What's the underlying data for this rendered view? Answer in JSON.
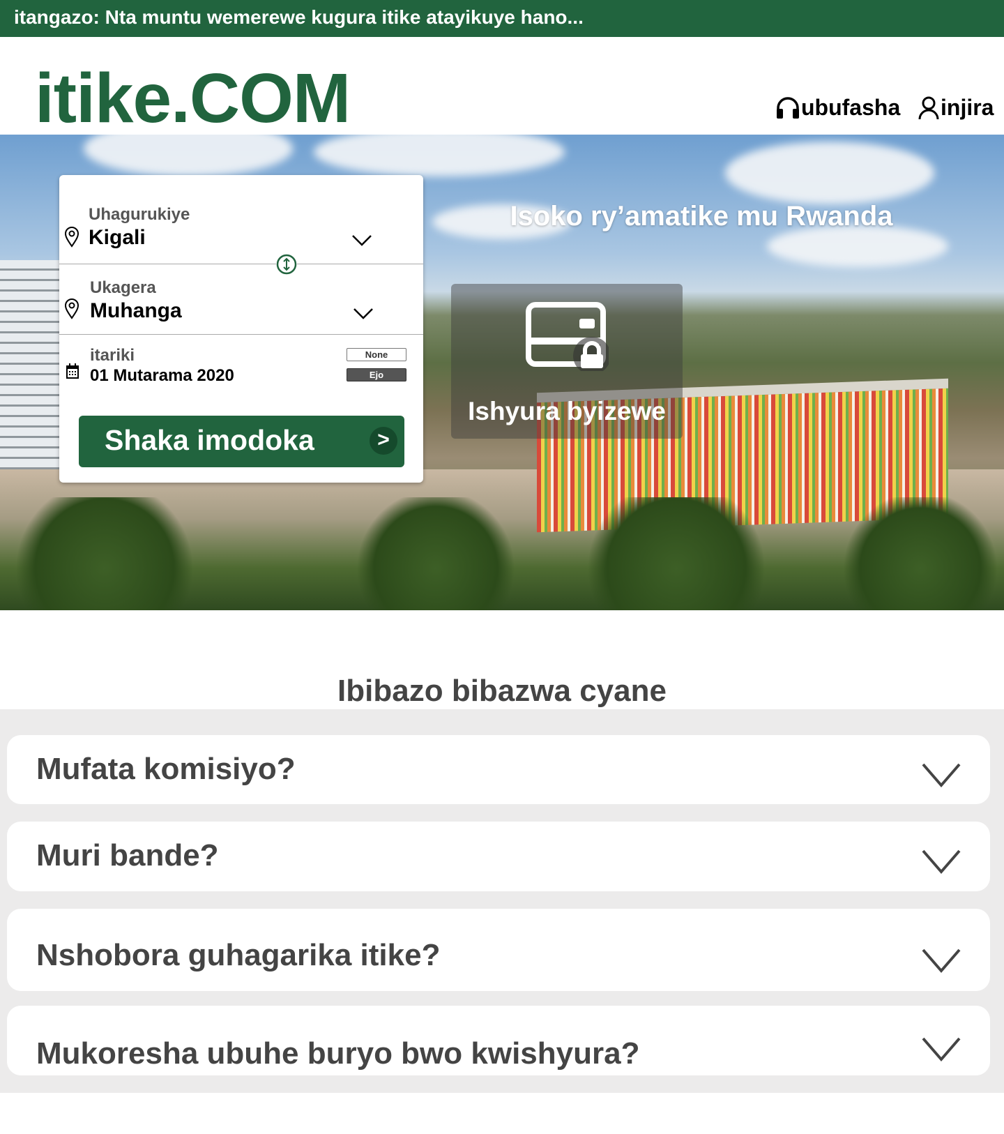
{
  "announcement": "itangazo: Nta muntu wemerewe kugura itike atayikuye hano...",
  "header": {
    "logo": "itike.COM",
    "help": "ubufasha",
    "login": "injira"
  },
  "hero": {
    "title": "Isoko ry’amatike mu Rwanda",
    "payment_label": "Ishyura byizewe"
  },
  "search": {
    "from_label": "Uhagurukiye",
    "from_value": "Kigali",
    "to_label": "Ukagera",
    "to_value": "Muhanga",
    "date_label": "itariki",
    "date_value": "01 Mutarama 2020",
    "date_chip_none": "None",
    "date_chip_tomorrow": "Ejo",
    "submit_label": "Shaka imodoka",
    "submit_arrow": ">"
  },
  "faq": {
    "title": "Ibibazo bibazwa cyane",
    "items": [
      {
        "question": "Mufata komisiyo?"
      },
      {
        "question": "Muri bande?"
      },
      {
        "question": "Nshobora guhagarika itike?"
      },
      {
        "question": "Mukoresha ubuhe buryo bwo kwishyura?"
      }
    ]
  },
  "colors": {
    "brand": "#21643e",
    "faq_bg": "#ecebeb",
    "text_gray": "#444444"
  }
}
